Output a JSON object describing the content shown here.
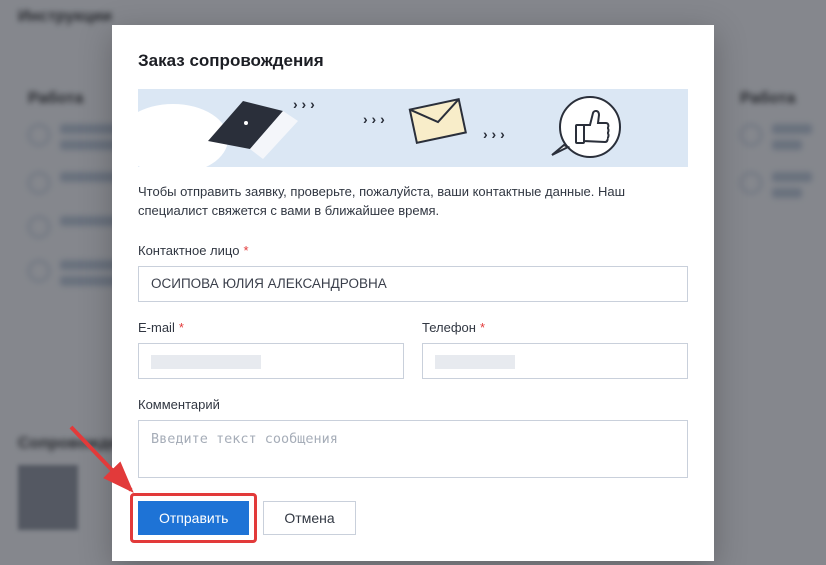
{
  "background": {
    "section1_title": "Инструкции",
    "section2_title": "Сопровождение",
    "col_left_title": "Работа",
    "col_right_title": "Работа"
  },
  "modal": {
    "title": "Заказ сопровождения",
    "description": "Чтобы отправить заявку, проверьте, пожалуйста, ваши контактные данные. Наш специалист свяжется с вами в ближайшее время.",
    "contact_label": "Контактное лицо",
    "contact_value": "ОСИПОВА ЮЛИЯ АЛЕКСАНДРОВНА",
    "email_label": "E-mail",
    "email_value": "",
    "phone_label": "Телефон",
    "phone_value": "",
    "comment_label": "Комментарий",
    "comment_placeholder": "Введите текст сообщения",
    "submit_label": "Отправить",
    "cancel_label": "Отмена"
  }
}
